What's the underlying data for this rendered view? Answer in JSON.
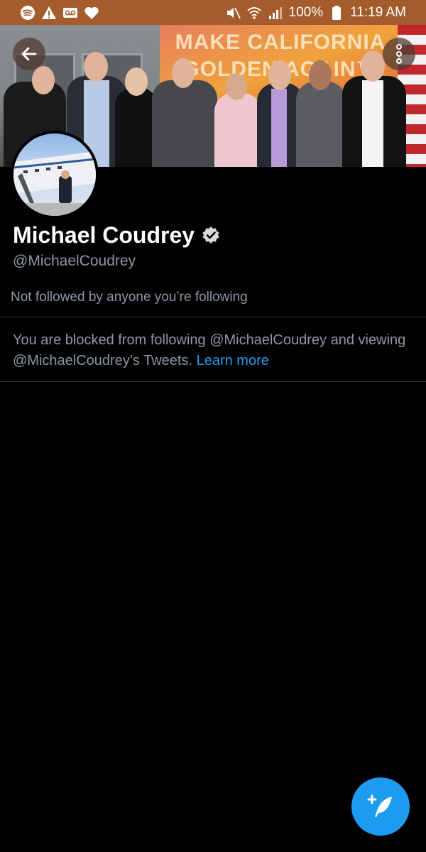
{
  "status_bar": {
    "battery": "100%",
    "time": "11:19 AM",
    "left_icons": [
      "spotify-icon",
      "warning-icon",
      "voicemail-icon",
      "heart-icon"
    ],
    "right_icons": [
      "mute-icon",
      "wifi-icon",
      "signal-icon",
      "battery-icon"
    ],
    "background_color": "#a45c2c"
  },
  "banner": {
    "sign_text": "MAKE CALIFORNIA\nGOLDEN AGAIN™"
  },
  "profile": {
    "display_name": "Michael Coudrey",
    "handle": "@MichaelCoudrey",
    "verified": true,
    "followed_by": "Not followed by anyone you’re following"
  },
  "blocked_notice": {
    "text": "You are blocked from following @MichaelCoudrey and viewing @MichaelCoudrey’s Tweets.",
    "link_label": "Learn more"
  },
  "colors": {
    "accent": "#1d9bf0",
    "secondary_text": "#8b98a5",
    "background": "#000000"
  }
}
